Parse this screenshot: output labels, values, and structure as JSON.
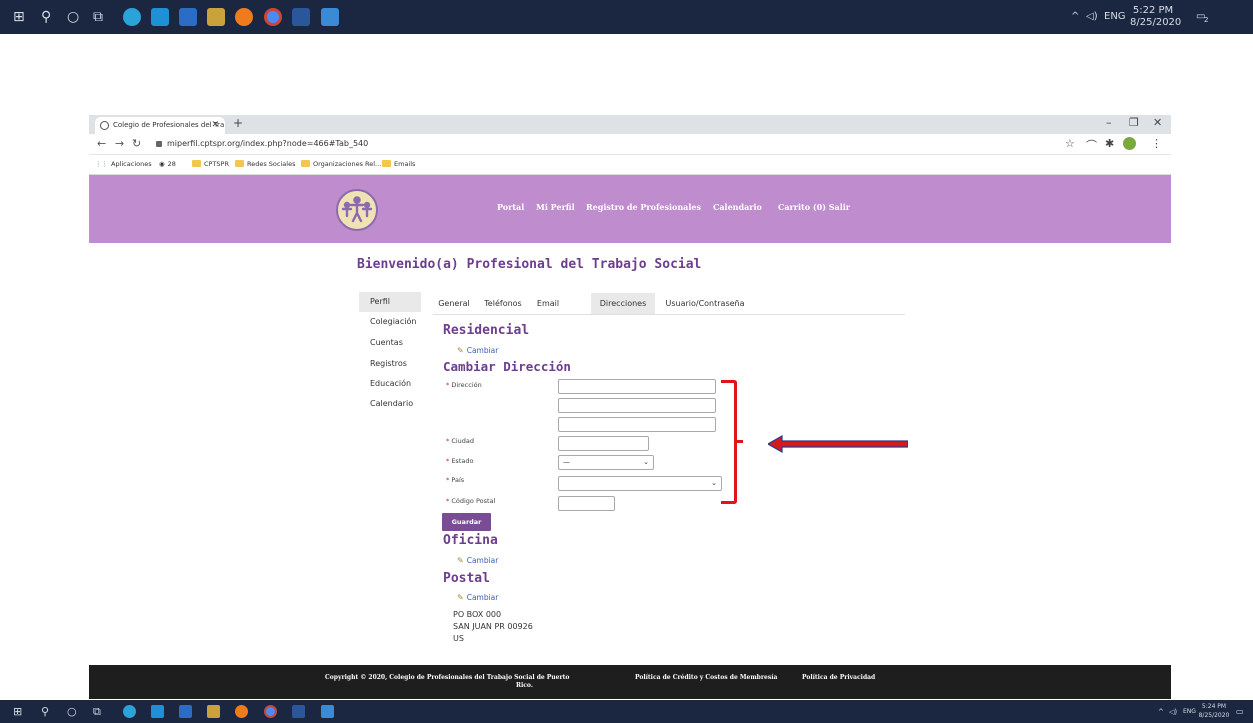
{
  "os": {
    "top_time": "5:22 PM",
    "top_date": "8/25/2020",
    "bottom_time": "5:24 PM",
    "bottom_date": "8/25/2020",
    "lang": "ENG",
    "notif_count": "2"
  },
  "browser": {
    "tab_title": "Colegio de Profesionales del Tra",
    "url": "miperfil.cptspr.org/index.php?node=466#Tab_540",
    "bookmarks": [
      "Aplicaciones",
      "28",
      "CPTSPR",
      "Redes Sociales",
      "Organizaciones Rel...",
      "Emails"
    ]
  },
  "header": {
    "nav": [
      "Portal",
      "Mi Perfil",
      "Registro de Profesionales",
      "Calendario",
      "Carrito (0) Salir"
    ]
  },
  "page": {
    "welcome": "Bienvenido(a) Profesional del Trabajo Social",
    "side_menu": [
      "Perfil",
      "Colegiación",
      "Cuentas",
      "Registros",
      "Educación",
      "Calendario"
    ],
    "tabs": [
      "General",
      "Teléfonos",
      "Email",
      "Direcciones",
      "Usuario/Contraseña"
    ],
    "sections": {
      "residencial": "Residencial",
      "cambiar_direccion": "Cambiar Dirección",
      "oficina": "Oficina",
      "postal": "Postal"
    },
    "cambiar": "Cambiar",
    "form": {
      "required_mark": "*",
      "direccion": "Dirección",
      "ciudad": "Ciudad",
      "estado": "Estado",
      "estado_value": "—",
      "pais": "País",
      "codigo_postal": "Código Postal"
    },
    "save_label": "Guardar",
    "postal_address": [
      "PO BOX 000",
      "SAN JUAN PR 00926",
      "US"
    ]
  },
  "footer": {
    "copyright_1": "Copyright © 2020, Colegio de Profesionales del Trabajo Social de Puerto",
    "copyright_2": "Rico.",
    "link_credit": "Política de Crédito y Costos de Membresía",
    "link_privacy": "Política de Privacidad"
  }
}
